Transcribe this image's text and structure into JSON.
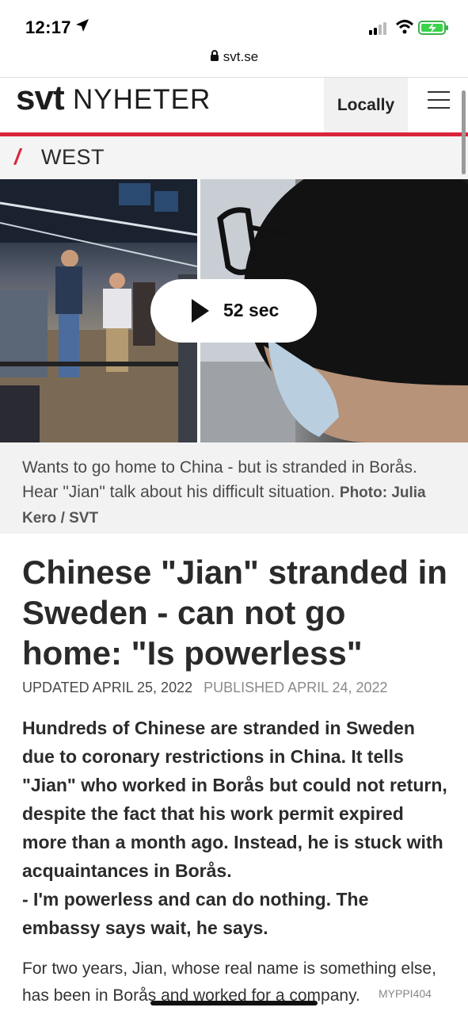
{
  "status_bar": {
    "time": "12:17",
    "icons": [
      "location-arrow-icon",
      "signal-icon",
      "wifi-icon",
      "battery-charging-icon"
    ]
  },
  "browser": {
    "url": "svt.se"
  },
  "site": {
    "logo_svt": "svt",
    "logo_nyheter": "NYHETER",
    "locally_button": "Locally",
    "section_slash": "/",
    "section_name": "WEST",
    "brand_color": "#d9253a"
  },
  "video": {
    "duration": "52 sec"
  },
  "caption": {
    "text": "Wants to go home to China - but is stranded in Borås. Hear \"Jian\" talk about his difficult situation.",
    "credit": "Photo: Julia Kero / SVT"
  },
  "article": {
    "headline": "Chinese \"Jian\" stranded in Sweden - can not go home: \"Is powerless\"",
    "updated": "UPDATED APRIL 25, 2022",
    "published": "PUBLISHED APRIL 24, 2022",
    "lede": "Hundreds of Chinese are stranded in Sweden due to coronary restrictions in China. It tells \"Jian\" who worked in Borås but could not return, despite the fact that his work permit expired more than a month ago. Instead, he is stuck with acquaintances in Borås.",
    "lede_quote": "- I'm powerless and can do nothing. The embassy says wait, he says.",
    "body": "For two years, Jian, whose real name is something else, has been in Borås and worked for a company."
  },
  "watermark": "MYPPI404"
}
